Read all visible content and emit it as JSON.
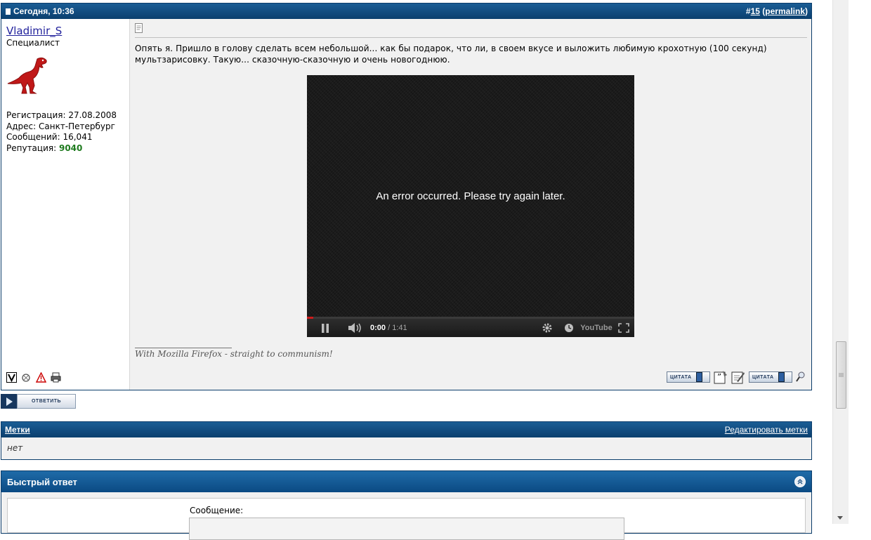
{
  "post": {
    "date": "Сегодня, 10:36",
    "hash": "#",
    "number": "15",
    "permalink_open": " (",
    "permalink": "permalink",
    "permalink_close": ")",
    "user": {
      "name": "Vladimir_S",
      "title": "Специалист",
      "reg_label": "Регистрация:",
      "reg_value": "27.08.2008",
      "addr_label": "Адрес:",
      "addr_value": "Санкт-Петербург",
      "msgs_label": "Сообщений:",
      "msgs_value": "16,041",
      "rep_label": "Репутация:",
      "rep_value": "9040"
    },
    "text": "Опять я. Пришло в голову сделать всем небольшой... как бы подарок, что ли, в своем вкусе и выложить любимую крохотную (100 секунд) мультзарисовку. Такую... сказочную-сказочную и очень новогоднюю.",
    "video": {
      "error": "An error occurred. Please try again later.",
      "time_current": "0:00",
      "time_sep": " / ",
      "time_duration": "1:41",
      "progress_fraction": 0.02,
      "logo": "YouTube"
    },
    "signature": "With Mozilla Firefox - straight to communism!",
    "buttons": {
      "quote": "ЦИТАТА",
      "multiquote": "ЦИТАТА"
    }
  },
  "reply_button": "ОТВЕТИТЬ",
  "tags": {
    "title": "Метки",
    "edit": "Редактировать метки",
    "value": "нет"
  },
  "quick_reply": {
    "title": "Быстрый ответ",
    "message_label": "Сообщение:"
  },
  "colors": {
    "header": "#0b3f6e",
    "reputation": "#1e7a1e",
    "link": "#22229c"
  }
}
